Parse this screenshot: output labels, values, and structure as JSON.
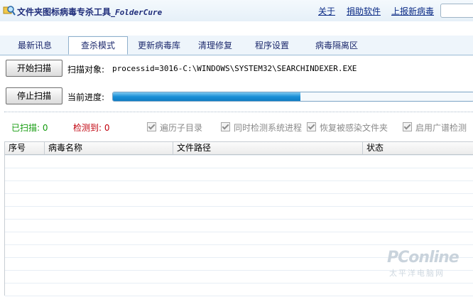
{
  "window": {
    "title": "文件夹图标病毒专杀工具_",
    "title_suffix": "FolderCure",
    "links": [
      "关于",
      "捐助软件",
      "上报新病毒"
    ]
  },
  "tabs": [
    {
      "label": "最新讯息",
      "active": false
    },
    {
      "label": "查杀模式",
      "active": true
    },
    {
      "label": "更新病毒库",
      "active": false
    },
    {
      "label": "清理修复",
      "active": false
    },
    {
      "label": "程序设置",
      "active": false
    },
    {
      "label": "病毒隔离区",
      "active": false
    }
  ],
  "scan": {
    "start_button": "开始扫描",
    "stop_button": "停止扫描",
    "target_label": "扫描对象:",
    "target_value": "processid=3016-C:\\WINDOWS\\SYSTEM32\\SEARCHINDEXER.EXE",
    "progress_label": "当前进度:",
    "progress_fraction": 0.52
  },
  "status": {
    "scanned_label": "已扫描:",
    "scanned_value": "0",
    "detected_label": "检测到:",
    "detected_value": "0"
  },
  "options": [
    "遍历子目录",
    "同时检测系统进程",
    "恢复被感染文件夹",
    "启用广谱检测"
  ],
  "table": {
    "columns": [
      "序号",
      "病毒名称",
      "文件路径",
      "状态"
    ]
  },
  "watermark": {
    "brand": "PConline",
    "sub": "太平洋电脑网"
  },
  "colors": {
    "accent": "#1a8fd7",
    "scanned": "#149b0e",
    "detected": "#c0000c"
  }
}
